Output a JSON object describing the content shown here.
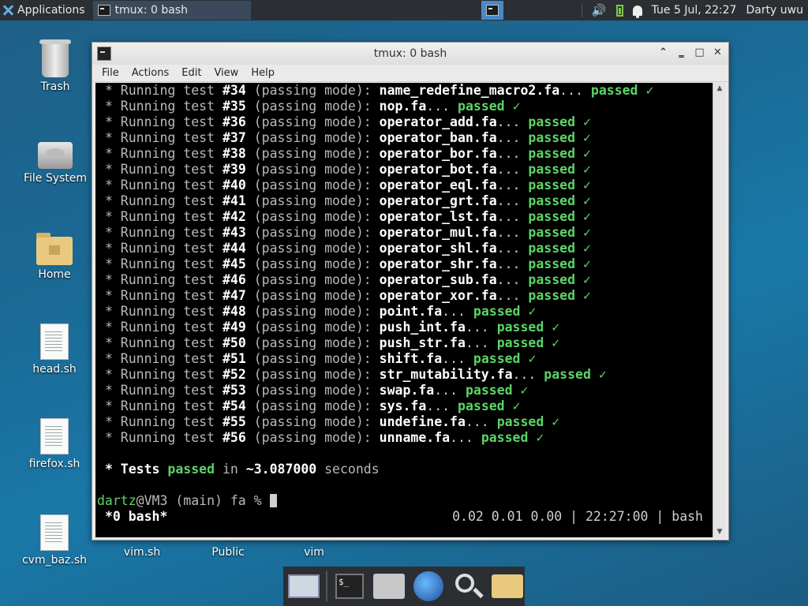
{
  "panel": {
    "applications_label": "Applications",
    "task_label": "tmux: 0 bash",
    "clock": "Tue  5 Jul, 22:27",
    "user": "Darty uwu"
  },
  "desktop_icons": {
    "trash": "Trash",
    "filesystem": "File System",
    "home": "Home",
    "head": "head.sh",
    "firefox": "firefox.sh",
    "cvm_baz": "cvm_baz.sh",
    "vim_sh": "vim.sh",
    "public": "Public",
    "vim": "vim"
  },
  "window": {
    "title": "tmux: 0 bash",
    "menu": [
      "File",
      "Actions",
      "Edit",
      "View",
      "Help"
    ]
  },
  "terminal": {
    "test_prefix": "* Running test",
    "mode_text": "(passing mode):",
    "passed_word": "passed",
    "check": "✓",
    "tests": [
      {
        "num": "#34",
        "file": "name_redefine_macro2.fa"
      },
      {
        "num": "#35",
        "file": "nop.fa"
      },
      {
        "num": "#36",
        "file": "operator_add.fa"
      },
      {
        "num": "#37",
        "file": "operator_ban.fa"
      },
      {
        "num": "#38",
        "file": "operator_bor.fa"
      },
      {
        "num": "#39",
        "file": "operator_bot.fa"
      },
      {
        "num": "#40",
        "file": "operator_eql.fa"
      },
      {
        "num": "#41",
        "file": "operator_grt.fa"
      },
      {
        "num": "#42",
        "file": "operator_lst.fa"
      },
      {
        "num": "#43",
        "file": "operator_mul.fa"
      },
      {
        "num": "#44",
        "file": "operator_shl.fa"
      },
      {
        "num": "#45",
        "file": "operator_shr.fa"
      },
      {
        "num": "#46",
        "file": "operator_sub.fa"
      },
      {
        "num": "#47",
        "file": "operator_xor.fa"
      },
      {
        "num": "#48",
        "file": "point.fa"
      },
      {
        "num": "#49",
        "file": "push_int.fa"
      },
      {
        "num": "#50",
        "file": "push_str.fa"
      },
      {
        "num": "#51",
        "file": "shift.fa"
      },
      {
        "num": "#52",
        "file": "str_mutability.fa"
      },
      {
        "num": "#53",
        "file": "swap.fa"
      },
      {
        "num": "#54",
        "file": "sys.fa"
      },
      {
        "num": "#55",
        "file": "undefine.fa"
      },
      {
        "num": "#56",
        "file": "unname.fa"
      }
    ],
    "summary": {
      "prefix": "* Tests",
      "passed": "passed",
      "middle": "in",
      "duration": "~3.087000",
      "suffix": "seconds"
    },
    "prompt": {
      "user": "dartz",
      "host_path": "@VM3 (main) fa %"
    },
    "tmux": {
      "window": "*0 bash*",
      "status_right": "0.02 0.01 0.00 | 22:27:00 | bash"
    }
  },
  "colors": {
    "passed": "#5dd468",
    "terminal_bg": "#000000",
    "desktop": "#1a6a95",
    "panel": "#2b2f33"
  }
}
